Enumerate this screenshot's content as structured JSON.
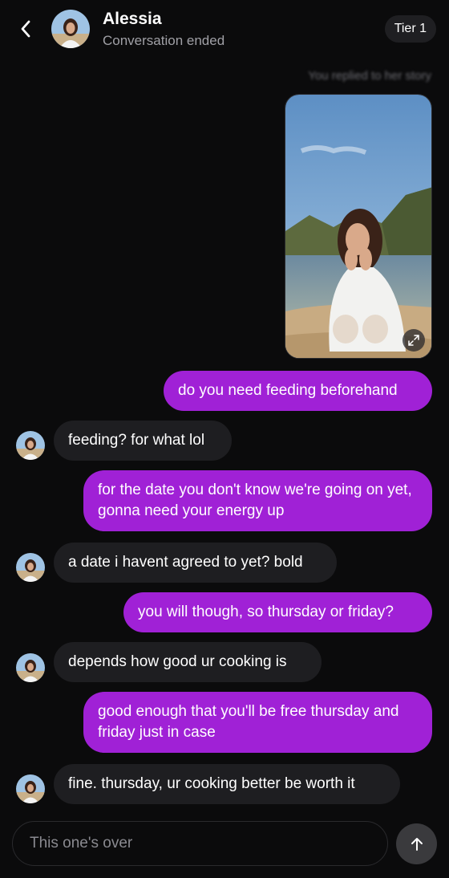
{
  "header": {
    "name": "Alessia",
    "status": "Conversation ended",
    "tier": "Tier 1"
  },
  "story": {
    "caption": "You replied to her story"
  },
  "messages": [
    {
      "dir": "out",
      "text": "do you need feeding beforehand"
    },
    {
      "dir": "in",
      "text": "feeding? for what lol"
    },
    {
      "dir": "out",
      "text": "for the date you don't know we're going on yet, gonna need your energy up"
    },
    {
      "dir": "in",
      "text": "a date i havent agreed to yet? bold"
    },
    {
      "dir": "out",
      "text": "you will though, so thursday or friday?"
    },
    {
      "dir": "in",
      "text": "depends how good ur cooking is"
    },
    {
      "dir": "out",
      "text": "good enough that you'll be free thursday and friday just in case"
    },
    {
      "dir": "in",
      "text": "fine. thursday, ur cooking better be worth it"
    }
  ],
  "composer": {
    "placeholder": "This one's over"
  },
  "colors": {
    "background": "#0b0b0c",
    "outgoing_bubble": "#a021d6",
    "incoming_bubble": "#1e1e21",
    "secondary_text": "#a0a0a6"
  },
  "icons": {
    "back": "chevron-left-icon",
    "expand": "expand-icon",
    "send": "arrow-up-icon"
  }
}
